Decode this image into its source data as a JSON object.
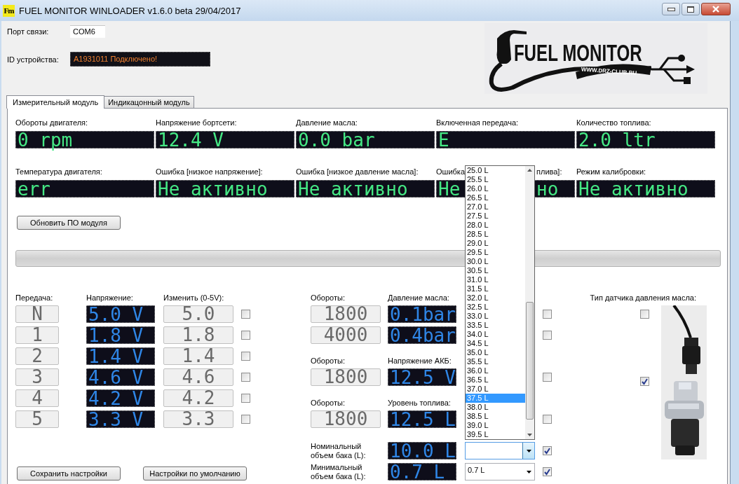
{
  "window": {
    "title": "FUEL MONITOR WINLOADER v1.6.0 beta 29/04/2017",
    "icon_text": "Fm"
  },
  "connection": {
    "port_label": "Порт связи:",
    "port_value": "COM6",
    "device_label": "ID устройства:",
    "device_value": "A1931011 Подключено!"
  },
  "logo": {
    "title": "FUEL MONITOR",
    "url": "WWW.DRZ-CLUB.RU"
  },
  "tabs": [
    {
      "label": "Измерительный модуль",
      "selected": true
    },
    {
      "label": "Индикацонный модуль",
      "selected": false
    }
  ],
  "readings": [
    {
      "kind": "full",
      "label": "Обороты двигателя:",
      "value": "0 rpm"
    },
    {
      "kind": "full",
      "label": "Напряжение бортсети:",
      "value": "12.4 V"
    },
    {
      "kind": "full",
      "label": "Давление масла:",
      "value": "0.0 bar"
    },
    {
      "kind": "full",
      "label": "Включенная передача:",
      "value": "E"
    },
    {
      "kind": "full",
      "label": "Количество топлива:",
      "value": "2.0 ltr"
    },
    {
      "kind": "full",
      "label": "Температура двигателя:",
      "value": "err"
    },
    {
      "kind": "full",
      "label": "Ошибка [низкое напряжение]:",
      "value": "Не активно"
    },
    {
      "kind": "full",
      "label": "Ошибка [низкое давление масла]:",
      "value": "Не активно"
    },
    {
      "kind": "covered",
      "label_parts": [
        "Ошибка",
        "плива]:"
      ],
      "value_parts": [
        "Не",
        "но"
      ]
    },
    {
      "kind": "full",
      "label": "Режим калибровки:",
      "value": "Не активно"
    }
  ],
  "update_button": "Обновить ПО модуля",
  "progress": {
    "level": 0
  },
  "gear_table": {
    "headers": [
      "Передача:",
      "Напряжение:",
      "Изменить (0-5V):"
    ],
    "rows": [
      {
        "gear": "N",
        "voltage": "5.0 V",
        "edit": "5.0",
        "checked": false
      },
      {
        "gear": "1",
        "voltage": "1.8 V",
        "edit": "1.8",
        "checked": false
      },
      {
        "gear": "2",
        "voltage": "1.4 V",
        "edit": "1.4",
        "checked": false
      },
      {
        "gear": "3",
        "voltage": "4.6 V",
        "edit": "4.6",
        "checked": false
      },
      {
        "gear": "4",
        "voltage": "4.2 V",
        "edit": "4.2",
        "checked": false
      },
      {
        "gear": "5",
        "voltage": "3.3 V",
        "edit": "3.3",
        "checked": false
      }
    ]
  },
  "calibration": [
    {
      "headers": [
        "Обороты:",
        "Давление масла:"
      ],
      "rows": [
        {
          "rpm": "1800",
          "value": "0.1bar",
          "checked": false
        },
        {
          "rpm": "4000",
          "value": "0.4bar",
          "checked": false
        }
      ]
    },
    {
      "headers": [
        "Обороты:",
        "Напряжение АКБ:"
      ],
      "rows": [
        {
          "rpm": "1800",
          "value": "12.5 V",
          "checked": false
        }
      ]
    },
    {
      "headers": [
        "Обороты:",
        "Уровень топлива:"
      ],
      "rows": [
        {
          "rpm": "1800",
          "value": "12.5 L",
          "checked": false
        }
      ]
    }
  ],
  "tank": [
    {
      "label": "Номинальный\nобъем бака (L):",
      "value": "10.0 L",
      "open": true,
      "checked": true
    },
    {
      "label": "Минимальный\nобъем бака (L):",
      "value": "0.7 L",
      "combo_value": "0.7 L",
      "open": false,
      "checked": true
    }
  ],
  "dropdown": {
    "items": [
      {
        "label": "25.0 L",
        "selected": false
      },
      {
        "label": "25.5 L",
        "selected": false
      },
      {
        "label": "26.0 L",
        "selected": false
      },
      {
        "label": "26.5 L",
        "selected": false
      },
      {
        "label": "27.0 L",
        "selected": false
      },
      {
        "label": "27.5 L",
        "selected": false
      },
      {
        "label": "28.0 L",
        "selected": false
      },
      {
        "label": "28.5 L",
        "selected": false
      },
      {
        "label": "29.0 L",
        "selected": false
      },
      {
        "label": "29.5 L",
        "selected": false
      },
      {
        "label": "30.0 L",
        "selected": false
      },
      {
        "label": "30.5 L",
        "selected": false
      },
      {
        "label": "31.0 L",
        "selected": false
      },
      {
        "label": "31.5 L",
        "selected": false
      },
      {
        "label": "32.0 L",
        "selected": false
      },
      {
        "label": "32.5 L",
        "selected": false
      },
      {
        "label": "33.0 L",
        "selected": false
      },
      {
        "label": "33.5 L",
        "selected": false
      },
      {
        "label": "34.0 L",
        "selected": false
      },
      {
        "label": "34.5 L",
        "selected": false
      },
      {
        "label": "35.0 L",
        "selected": false
      },
      {
        "label": "35.5 L",
        "selected": false
      },
      {
        "label": "36.0 L",
        "selected": false
      },
      {
        "label": "36.5 L",
        "selected": false
      },
      {
        "label": "37.0 L",
        "selected": false
      },
      {
        "label": "37.5 L",
        "selected": true
      },
      {
        "label": "38.0 L",
        "selected": false
      },
      {
        "label": "38.5 L",
        "selected": false
      },
      {
        "label": "39.0 L",
        "selected": false
      },
      {
        "label": "39.5 L",
        "selected": false
      }
    ]
  },
  "sensor": {
    "label": "Тип датчика давления масла:",
    "options": [
      {
        "checked": false
      },
      {
        "checked": true
      }
    ]
  },
  "buttons": [
    "Сохранить настройки",
    "Настройки по умолчанию"
  ]
}
